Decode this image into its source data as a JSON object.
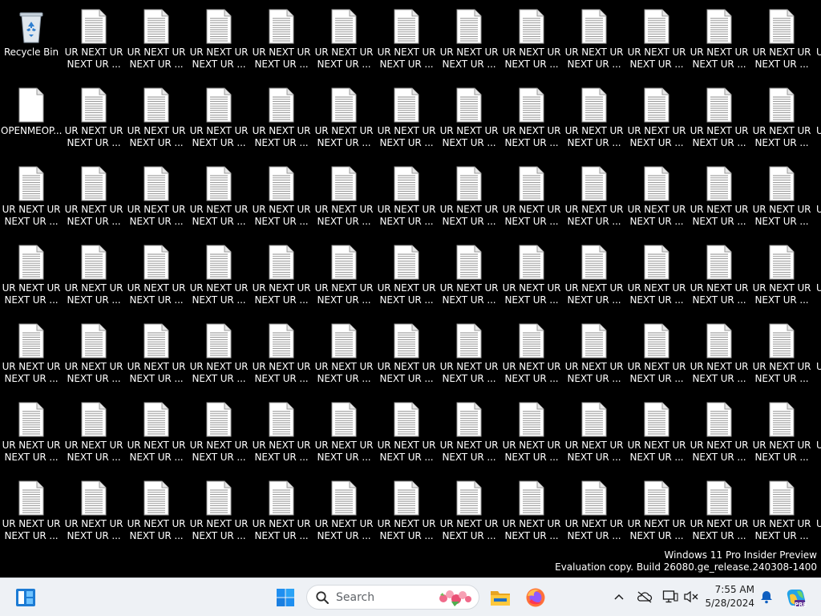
{
  "desktop": {
    "recycle_bin_label": "Recycle Bin",
    "openmeop_label": "OPENMEOP...",
    "file_label": "UR NEXT UR\nNEXT UR ...",
    "cut_label": "U"
  },
  "watermark": {
    "line1": "Windows 11 Pro Insider Preview",
    "line2": "Evaluation copy. Build 26080.ge_release.240308-1400"
  },
  "taskbar": {
    "search_placeholder": "Search",
    "time": "7:55 AM",
    "date": "5/28/2024",
    "accent": "#0067c0"
  }
}
